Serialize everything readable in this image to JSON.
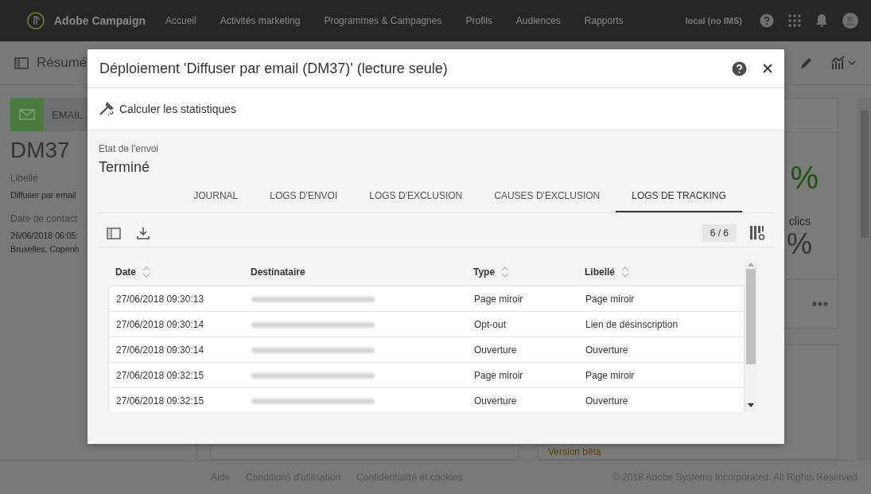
{
  "app": {
    "name": "Adobe Campaign"
  },
  "nav": {
    "items": [
      {
        "label": "Accueil"
      },
      {
        "label": "Activités marketing"
      },
      {
        "label": "Programmes & Campagnes"
      },
      {
        "label": "Profils"
      },
      {
        "label": "Audiences"
      },
      {
        "label": "Rapports"
      }
    ],
    "instance": "local (no IMS)"
  },
  "page": {
    "title": "Résumé",
    "channel": "EMAIL",
    "code": "DM37",
    "fields": [
      {
        "label": "Libellé",
        "lines": [
          "Diffuser par email"
        ]
      },
      {
        "label": "Date de contact",
        "lines": [
          "26/06/2018 06:05:",
          "Bruxelles, Copenh"
        ]
      }
    ],
    "stats": {
      "rate": "%",
      "clicks_label": "clics",
      "clicks_rate": "%"
    },
    "beta_label": "Version bêta"
  },
  "footer": {
    "links": [
      "Aide",
      "Conditions d'utilisation",
      "Confidentialité et cookies"
    ],
    "copyright": "© 2018 Adobe Systems Incorporated. All Rights Reserved."
  },
  "dialog": {
    "title": "Déploiement 'Diffuser par email (DM37)' (lecture seule)",
    "action": "Calculer les statistiques",
    "status_label": "Etat de l'envoi",
    "status": "Terminé",
    "tabs": [
      {
        "label": "JOURNAL",
        "selected": false
      },
      {
        "label": "LOGS D'ENVOI",
        "selected": false
      },
      {
        "label": "LOGS D'EXCLUSION",
        "selected": false
      },
      {
        "label": "CAUSES D'EXCLUSION",
        "selected": false
      },
      {
        "label": "LOGS DE TRACKING",
        "selected": true
      }
    ],
    "count": "6 / 6",
    "table": {
      "columns": [
        {
          "label": "Date",
          "sortable": true,
          "kind": "text"
        },
        {
          "label": "Destinataire",
          "sortable": false,
          "kind": "redacted"
        },
        {
          "label": "Type",
          "sortable": true,
          "kind": "text"
        },
        {
          "label": "Libellé",
          "sortable": true,
          "kind": "text"
        }
      ],
      "rows": [
        {
          "cells": [
            "27/06/2018 09:30:13",
            "",
            "Page miroir",
            "Page miroir"
          ]
        },
        {
          "cells": [
            "27/06/2018 09:30:14",
            "",
            "Opt-out",
            "Lien de désinscription"
          ]
        },
        {
          "cells": [
            "27/06/2018 09:30:14",
            "",
            "Ouverture",
            "Ouverture"
          ]
        },
        {
          "cells": [
            "27/06/2018 09:32:15",
            "",
            "Page miroir",
            "Page miroir"
          ]
        },
        {
          "cells": [
            "27/06/2018 09:32:15",
            "",
            "Ouverture",
            "Ouverture"
          ]
        }
      ]
    }
  }
}
